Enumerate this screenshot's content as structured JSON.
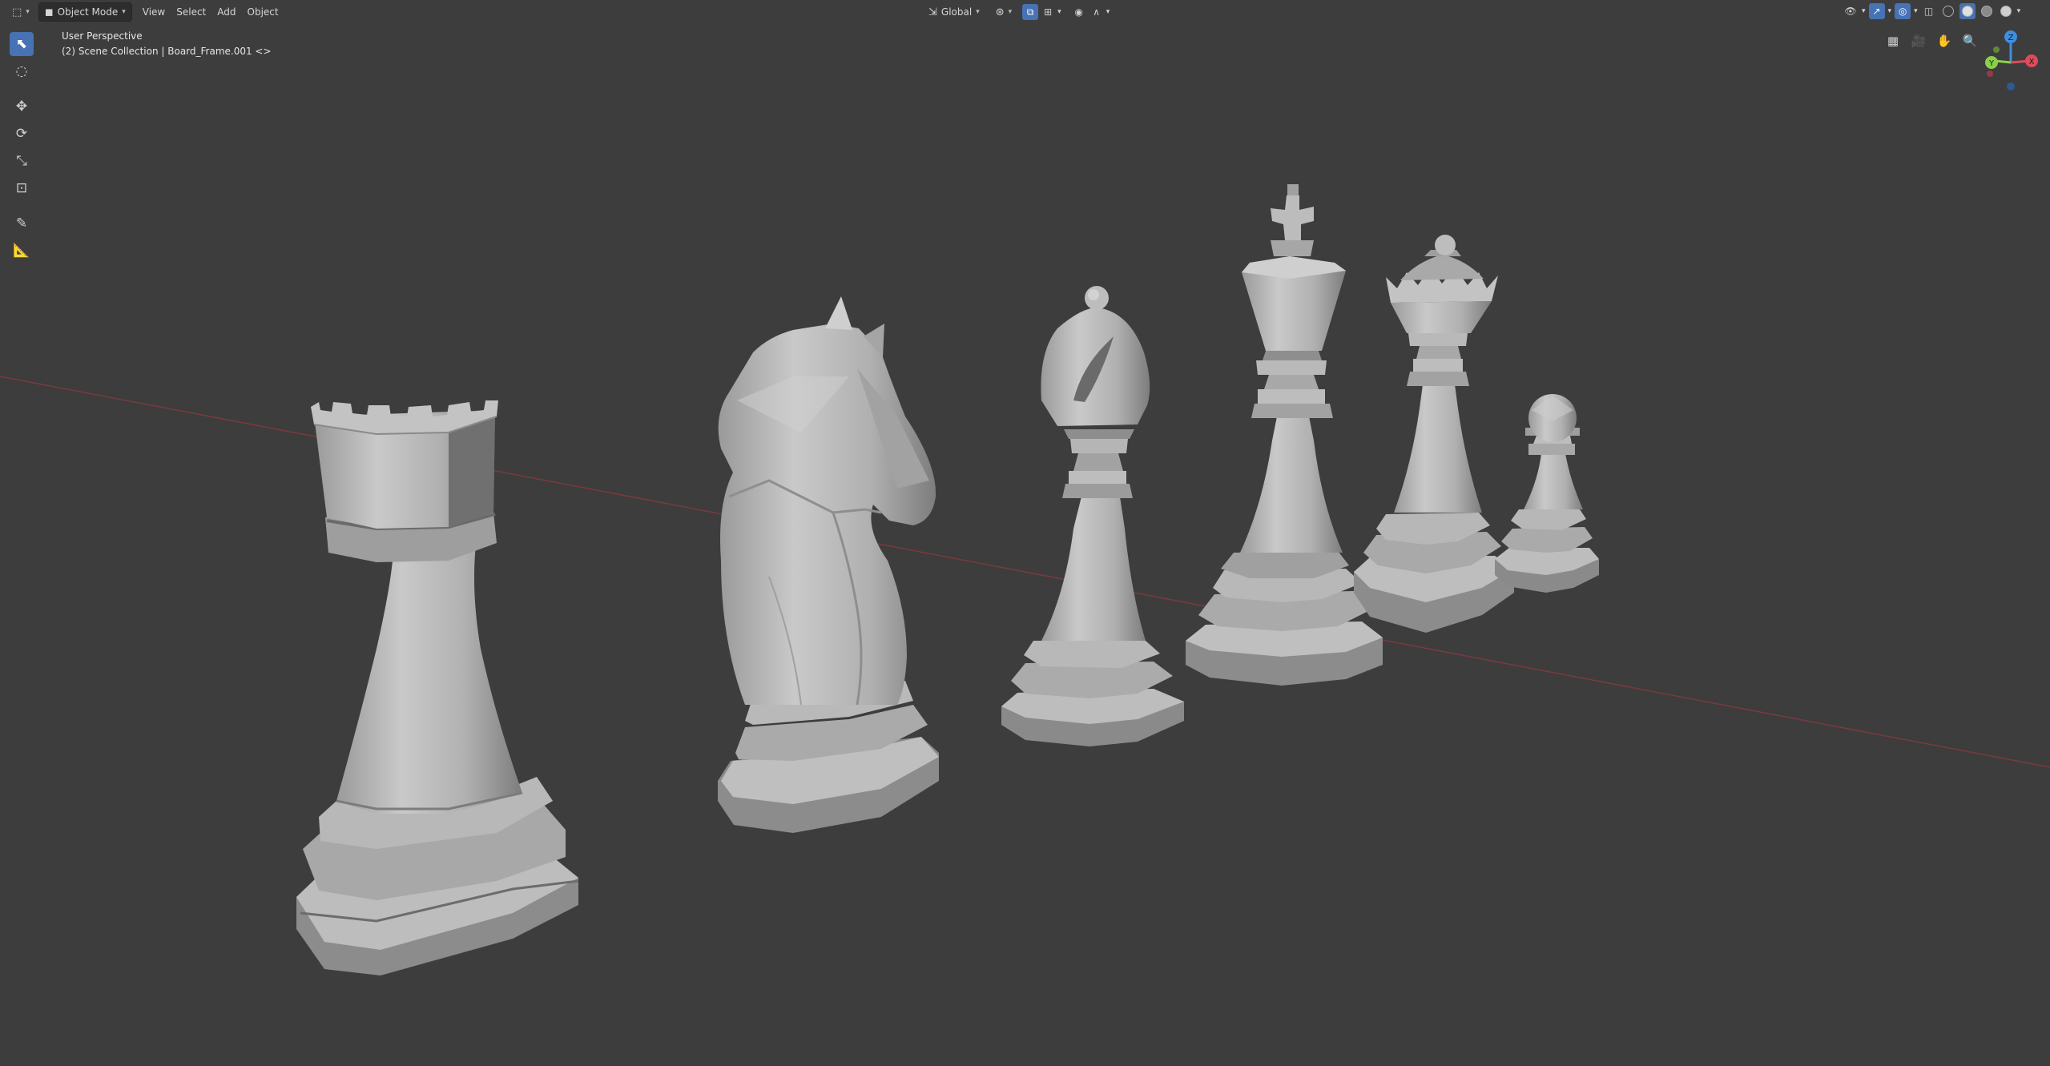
{
  "header": {
    "editor_icon": "3d-viewport-icon",
    "mode": "Object Mode",
    "menus": [
      "View",
      "Select",
      "Add",
      "Object"
    ],
    "transform_orientation": "Global"
  },
  "viewport": {
    "perspective_label": "User Perspective",
    "collection_label": "(2) Scene Collection | Board_Frame.001 <>"
  },
  "toolbar": {
    "tools": [
      "select-box-icon",
      "cursor-icon",
      "move-icon",
      "rotate-icon",
      "scale-icon",
      "transform-icon",
      "annotate-icon",
      "measure-icon"
    ]
  },
  "navigation": {
    "buttons": [
      "grid-view-icon",
      "camera-icon",
      "hand-pan-icon",
      "zoom-icon"
    ],
    "axes": [
      "X",
      "Y",
      "Z"
    ]
  },
  "colors": {
    "background": "#3d3d3d",
    "accent": "#4772b3",
    "x_axis": "#e04b5a",
    "y_axis": "#8bd04b",
    "z_axis": "#3d8fe0",
    "piece": "#b4b4b4"
  },
  "scene_objects": [
    "Rook",
    "Knight",
    "Bishop",
    "King",
    "Queen",
    "Pawn"
  ]
}
